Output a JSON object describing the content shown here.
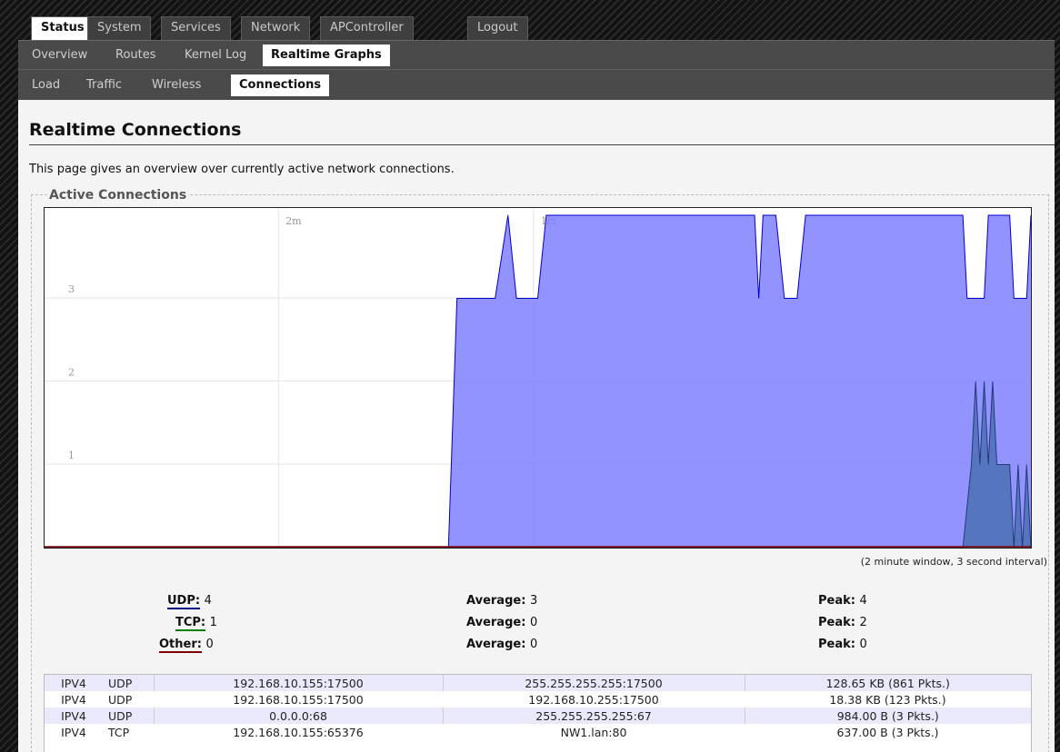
{
  "nav": {
    "top_tabs": [
      "Status",
      "System",
      "Services",
      "Network",
      "APController",
      "Logout"
    ],
    "sub_tabs": [
      "Overview",
      "Routes",
      "Kernel Log",
      "Realtime Graphs"
    ],
    "graph_tabs": [
      "Load",
      "Traffic",
      "Wireless",
      "Connections"
    ]
  },
  "page": {
    "title": "Realtime Connections",
    "description": "This page gives an overview over currently active network connections.",
    "section_legend": "Active Connections",
    "window_note": "(2 minute window, 3 second interval)"
  },
  "stats": [
    {
      "label": "UDP:",
      "value": "4",
      "avg_label": "Average:",
      "avg": "3",
      "peak_label": "Peak:",
      "peak": "4",
      "color": "#000080"
    },
    {
      "label": "TCP:",
      "value": "1",
      "avg_label": "Average:",
      "avg": "0",
      "peak_label": "Peak:",
      "peak": "2",
      "color": "#008000"
    },
    {
      "label": "Other:",
      "value": "0",
      "avg_label": "Average:",
      "avg": "0",
      "peak_label": "Peak:",
      "peak": "0",
      "color": "#800000"
    }
  ],
  "connections": [
    {
      "family": "IPV4",
      "proto": "UDP",
      "src": "192.168.10.155:17500",
      "dst": "255.255.255.255:17500",
      "transfer": "128.65 KB (861 Pkts.)"
    },
    {
      "family": "IPV4",
      "proto": "UDP",
      "src": "192.168.10.155:17500",
      "dst": "192.168.10.255:17500",
      "transfer": "18.38 KB (123 Pkts.)"
    },
    {
      "family": "IPV4",
      "proto": "UDP",
      "src": "0.0.0.0:68",
      "dst": "255.255.255.255:67",
      "transfer": "984.00 B (3 Pkts.)"
    },
    {
      "family": "IPV4",
      "proto": "TCP",
      "src": "192.168.10.155:65376",
      "dst": "NW1.lan:80",
      "transfer": "637.00 B (3 Pkts.)"
    }
  ],
  "chart_data": {
    "type": "area",
    "x_unit": "seconds ago",
    "x_ticks": [
      {
        "label": "2m",
        "x": 120
      },
      {
        "label": "1m",
        "x": 60
      }
    ],
    "y_ticks": [
      1,
      2,
      3
    ],
    "ylim": [
      0,
      4
    ],
    "xlim": [
      175,
      0
    ],
    "series": [
      {
        "name": "UDP",
        "fill": "#8080ff",
        "stroke": "#0000cc",
        "points": [
          [
            175,
            0
          ],
          [
            80,
            0
          ],
          [
            78,
            3
          ],
          [
            69,
            3
          ],
          [
            66,
            4
          ],
          [
            64,
            3
          ],
          [
            59,
            3
          ],
          [
            57,
            4
          ],
          [
            8,
            4
          ],
          [
            7,
            3
          ],
          [
            6,
            4
          ],
          [
            3,
            4
          ],
          [
            1,
            3
          ],
          [
            -2,
            3
          ],
          [
            -4,
            4
          ],
          [
            -41,
            4
          ],
          [
            -42,
            3
          ],
          [
            -46,
            3
          ],
          [
            -47,
            4
          ],
          [
            -52,
            4
          ],
          [
            -53,
            3
          ],
          [
            -56,
            3
          ],
          [
            -57,
            4
          ]
        ]
      },
      {
        "name": "TCP",
        "fill": "#4f72b8",
        "stroke": "#233a7a",
        "points": [
          [
            175,
            0
          ],
          [
            -41,
            0
          ],
          [
            -43,
            1
          ],
          [
            -44,
            2
          ],
          [
            -45,
            1
          ],
          [
            -46,
            2
          ],
          [
            -47,
            1
          ],
          [
            -48,
            2
          ],
          [
            -49,
            1
          ],
          [
            -52,
            1
          ],
          [
            -53,
            0
          ],
          [
            -54,
            1
          ],
          [
            -55,
            0
          ],
          [
            -56,
            1
          ],
          [
            -57,
            0
          ]
        ]
      }
    ]
  }
}
